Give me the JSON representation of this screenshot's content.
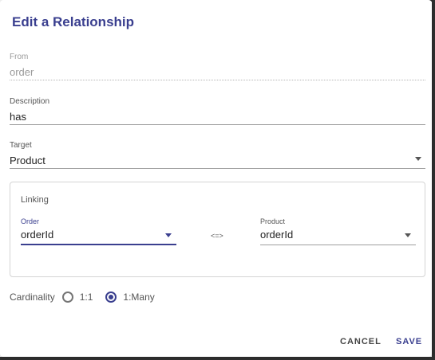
{
  "dialog": {
    "title": "Edit a Relationship",
    "from": {
      "label": "From",
      "value": "order"
    },
    "description": {
      "label": "Description",
      "value": "has"
    },
    "target": {
      "label": "Target",
      "value": "Product"
    },
    "linking": {
      "title": "Linking",
      "left": {
        "label": "Order",
        "value": "orderId"
      },
      "connector": "<=>",
      "right": {
        "label": "Product",
        "value": "orderId"
      }
    },
    "cardinality": {
      "label": "Cardinality",
      "options": [
        {
          "label": "1:1",
          "selected": false
        },
        {
          "label": "1:Many",
          "selected": true
        }
      ]
    },
    "actions": {
      "cancel": "CANCEL",
      "save": "SAVE"
    }
  },
  "colors": {
    "accent": "#3a3f8f",
    "backdrop": "#303030"
  },
  "icons": {
    "dropdown": "caret-down-icon"
  }
}
